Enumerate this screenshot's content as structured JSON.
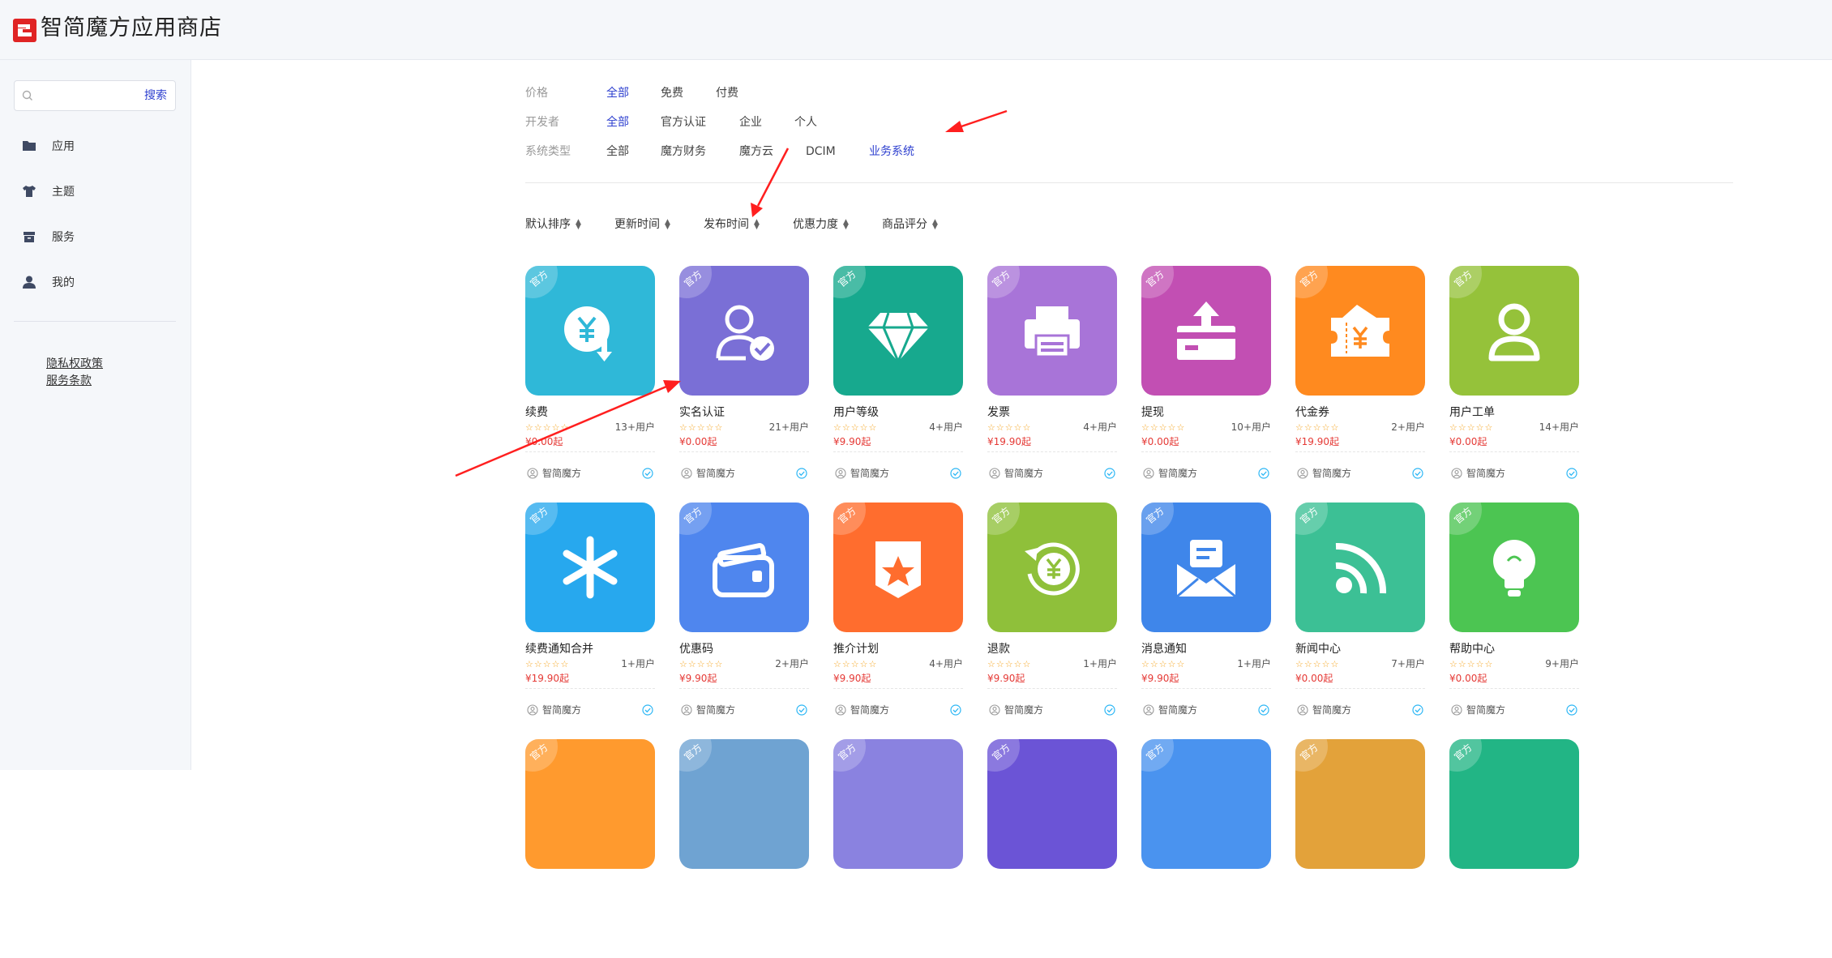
{
  "app": {
    "title": "智简魔方应用商店"
  },
  "sidebar": {
    "search": {
      "placeholder": "",
      "button_label": "搜索"
    },
    "nav": [
      {
        "label": "应用",
        "icon": "folder-icon"
      },
      {
        "label": "主题",
        "icon": "tshirt-icon"
      },
      {
        "label": "服务",
        "icon": "box-icon"
      },
      {
        "label": "我的",
        "icon": "user-icon"
      }
    ],
    "links": [
      {
        "label": "隐私权政策"
      },
      {
        "label": "服务条款"
      }
    ]
  },
  "filters": {
    "price": {
      "label": "价格",
      "options": [
        "全部",
        "免费",
        "付费"
      ],
      "selected": "全部"
    },
    "developer": {
      "label": "开发者",
      "options": [
        "全部",
        "官方认证",
        "企业",
        "个人"
      ],
      "selected": "全部"
    },
    "system_type": {
      "label": "系统类型",
      "options": [
        "全部",
        "魔方财务",
        "魔方云",
        "DCIM",
        "业务系统"
      ],
      "selected": "业务系统"
    }
  },
  "sort": [
    "默认排序",
    "更新时间",
    "发布时间",
    "优惠力度",
    "商品评分"
  ],
  "cards": [
    {
      "name": "续费",
      "users": "13+用户",
      "price": "¥0.00起",
      "developer": "智简魔方",
      "badge": "官方",
      "color": "#2fb8d8",
      "icon": "renew-yen-icon"
    },
    {
      "name": "实名认证",
      "users": "21+用户",
      "price": "¥0.00起",
      "developer": "智简魔方",
      "badge": "官方",
      "color": "#7a6fd6",
      "icon": "user-verified-icon"
    },
    {
      "name": "用户等级",
      "users": "4+用户",
      "price": "¥9.90起",
      "developer": "智简魔方",
      "badge": "官方",
      "color": "#17a98e",
      "icon": "diamond-icon"
    },
    {
      "name": "发票",
      "users": "4+用户",
      "price": "¥19.90起",
      "developer": "智简魔方",
      "badge": "官方",
      "color": "#a874d8",
      "icon": "printer-icon"
    },
    {
      "name": "提现",
      "users": "10+用户",
      "price": "¥0.00起",
      "developer": "智简魔方",
      "badge": "官方",
      "color": "#c24fb3",
      "icon": "withdraw-icon"
    },
    {
      "name": "代金券",
      "users": "2+用户",
      "price": "¥19.90起",
      "developer": "智简魔方",
      "badge": "官方",
      "color": "#ff8a1f",
      "icon": "voucher-icon"
    },
    {
      "name": "用户工单",
      "users": "14+用户",
      "price": "¥0.00起",
      "developer": "智简魔方",
      "badge": "官方",
      "color": "#95c23a",
      "icon": "user-ticket-icon"
    },
    {
      "name": "续费通知合并",
      "users": "1+用户",
      "price": "¥19.90起",
      "developer": "智简魔方",
      "badge": "官方",
      "color": "#27a8ee",
      "icon": "asterisk-icon"
    },
    {
      "name": "优惠码",
      "users": "2+用户",
      "price": "¥9.90起",
      "developer": "智简魔方",
      "badge": "官方",
      "color": "#4f86ee",
      "icon": "wallet-icon"
    },
    {
      "name": "推介计划",
      "users": "4+用户",
      "price": "¥9.90起",
      "developer": "智简魔方",
      "badge": "官方",
      "color": "#ff6d2e",
      "icon": "star-badge-icon"
    },
    {
      "name": "退款",
      "users": "1+用户",
      "price": "¥9.90起",
      "developer": "智简魔方",
      "badge": "官方",
      "color": "#8fc03a",
      "icon": "refund-icon"
    },
    {
      "name": "消息通知",
      "users": "1+用户",
      "price": "¥9.90起",
      "developer": "智简魔方",
      "badge": "官方",
      "color": "#3f86ea",
      "icon": "message-icon"
    },
    {
      "name": "新闻中心",
      "users": "7+用户",
      "price": "¥0.00起",
      "developer": "智简魔方",
      "badge": "官方",
      "color": "#3cc095",
      "icon": "rss-icon"
    },
    {
      "name": "帮助中心",
      "users": "9+用户",
      "price": "¥0.00起",
      "developer": "智简魔方",
      "badge": "官方",
      "color": "#4cc552",
      "icon": "lightbulb-icon"
    },
    {
      "badge": "官方",
      "color": "#ff9a2e"
    },
    {
      "badge": "官方",
      "color": "#6fa3d2"
    },
    {
      "badge": "官方",
      "color": "#8a82e0"
    },
    {
      "badge": "官方",
      "color": "#6b54d6"
    },
    {
      "badge": "官方",
      "color": "#4a93ef"
    },
    {
      "badge": "官方",
      "color": "#e3a23a"
    },
    {
      "badge": "官方",
      "color": "#22b585"
    }
  ],
  "rating_stars": "☆☆☆☆☆"
}
